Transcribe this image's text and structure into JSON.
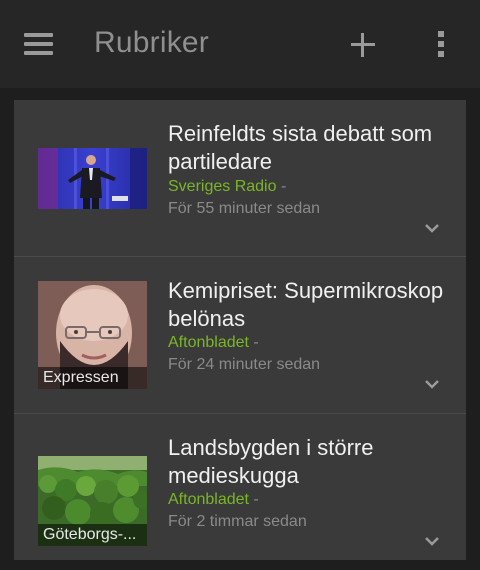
{
  "appbar": {
    "title": "Rubriker",
    "menu_icon": "hamburger-menu-icon",
    "add_icon": "plus-icon",
    "overflow_icon": "vertical-dots-icon"
  },
  "colors": {
    "appbar_bg": "#262626",
    "card_bg": "#3a3a3a",
    "source": "#7ab627",
    "headline": "#f0f0f0",
    "meta": "#8a8a8a"
  },
  "articles": [
    {
      "headline": "Reinfeldts sista debatt som partiledare",
      "source": "Sveriges Radio",
      "separator": "-",
      "time": "För 55 minuter sedan",
      "thumb_label": ""
    },
    {
      "headline": "Kemipriset: Supermikroskop belönas",
      "source": "Aftonbladet",
      "separator": "-",
      "time": "För 24 minuter sedan",
      "thumb_label": "Expressen"
    },
    {
      "headline": "Landsbygden i större medieskugga",
      "source": "Aftonbladet",
      "separator": "-",
      "time": "För 2 timmar sedan",
      "thumb_label": "Göteborgs-..."
    }
  ]
}
